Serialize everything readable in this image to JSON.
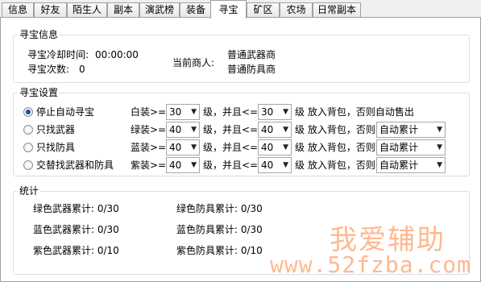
{
  "tabs": [
    "信息",
    "好友",
    "陌生人",
    "副本",
    "演武榜",
    "装备",
    "寻宝",
    "矿区",
    "农场",
    "日常副本"
  ],
  "active_tab": "寻宝",
  "treasure_info": {
    "title": "寻宝信息",
    "cooldown_label": "寻宝冷却时间:",
    "cooldown_value": "00:00:00",
    "count_label": "寻宝次数:",
    "count_value": "0",
    "merchant_label": "当前商人:",
    "merchants": [
      "普通武器商",
      "普通防具商"
    ]
  },
  "treasure_settings": {
    "title": "寻宝设置",
    "modes": [
      {
        "label": "停止自动寻宝",
        "selected": true
      },
      {
        "label": "只找武器",
        "selected": false
      },
      {
        "label": "只找防具",
        "selected": false
      },
      {
        "label": "交替找武器和防具",
        "selected": false
      }
    ],
    "rows": [
      {
        "prefix": "白装>=",
        "min": "30",
        "mid": "级，并且<=",
        "max": "30",
        "suffix": "级 放入背包，否则自动售出",
        "action": ""
      },
      {
        "prefix": "绿装>=",
        "min": "40",
        "mid": "级，并且<=",
        "max": "40",
        "suffix": "级 放入背包，否则",
        "action": "自动累计"
      },
      {
        "prefix": "蓝装>=",
        "min": "40",
        "mid": "级，并且<=",
        "max": "40",
        "suffix": "级 放入背包，否则",
        "action": "自动累计"
      },
      {
        "prefix": "紫装>=",
        "min": "40",
        "mid": "级，并且<=",
        "max": "40",
        "suffix": "级 放入背包，否则",
        "action": "自动累计"
      }
    ]
  },
  "stats": {
    "title": "统计",
    "items": [
      "绿色武器累计: 0/30",
      "绿色防具累计: 0/30",
      "蓝色武器累计: 0/30",
      "蓝色防具累计: 0/30",
      "紫色武器累计: 0/10",
      "紫色防具累计: 0/10"
    ]
  },
  "watermark": {
    "text": "我爱辅助",
    "url": "www.52fzba.com"
  }
}
